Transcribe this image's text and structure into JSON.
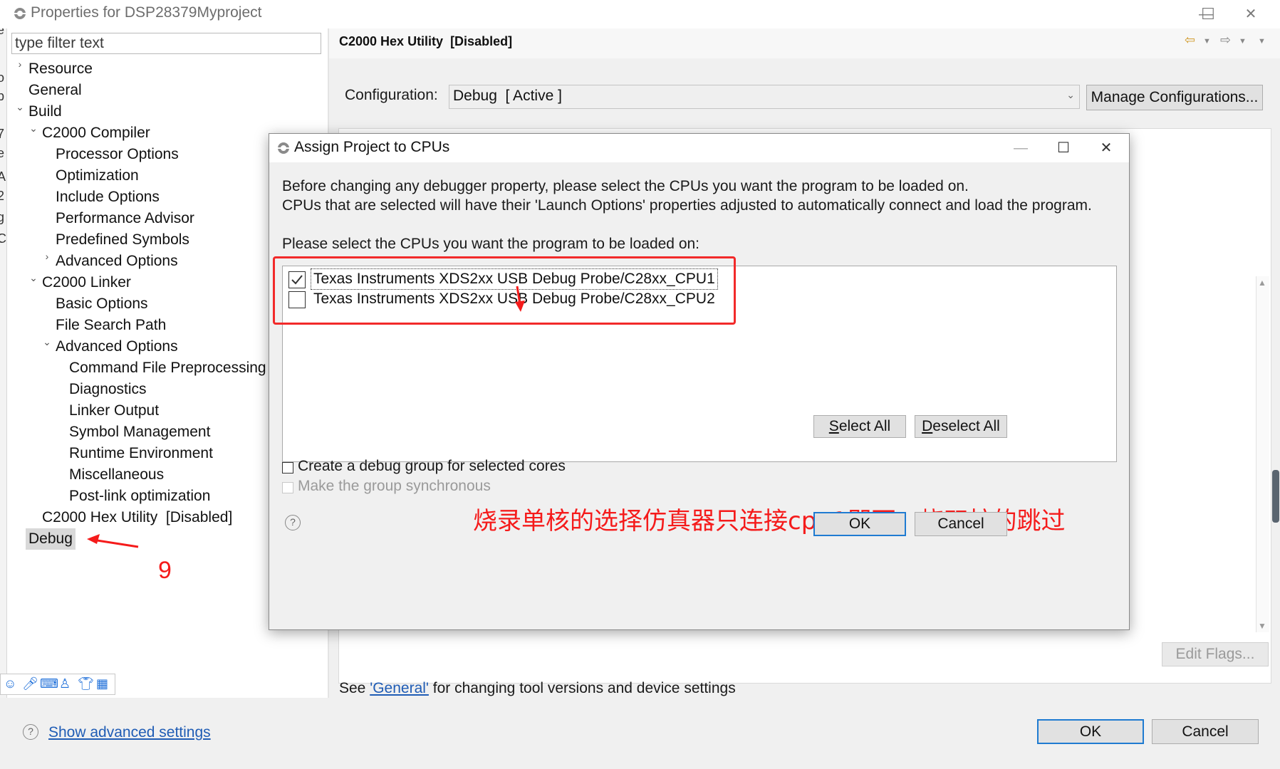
{
  "window": {
    "title": "Properties for DSP28379Myproject",
    "minimize_glyph": "—",
    "maximize_glyph": "☐",
    "close_glyph": "✕"
  },
  "left_strip_letters": [
    "e",
    "e",
    "o",
    "p",
    "7",
    "e",
    "A",
    "2",
    "g",
    "C"
  ],
  "filter": {
    "placeholder": "type filter text"
  },
  "tree": {
    "resource": "Resource",
    "general": "General",
    "build": "Build",
    "c2000_compiler": "C2000 Compiler",
    "processor_options": "Processor Options",
    "optimization": "Optimization",
    "include_options": "Include Options",
    "performance_advisor": "Performance Advisor",
    "predefined_symbols": "Predefined Symbols",
    "compiler_advanced_options": "Advanced Options",
    "c2000_linker": "C2000 Linker",
    "basic_options": "Basic Options",
    "file_search_path": "File Search Path",
    "linker_advanced_options": "Advanced Options",
    "command_file_preprocessing": "Command File Preprocessing",
    "diagnostics": "Diagnostics",
    "linker_output": "Linker Output",
    "symbol_management": "Symbol Management",
    "runtime_environment": "Runtime Environment",
    "miscellaneous": "Miscellaneous",
    "post_link_optimization": "Post-link optimization",
    "c2000_hex_utility": "C2000 Hex Utility  [Disabled]",
    "debug": "Debug"
  },
  "right_panel": {
    "header_title": "C2000 Hex Utility  [Disabled]",
    "configuration_label": "Configuration:",
    "configuration_value": "Debug  [ Active ]",
    "manage_configurations": "Manage Configurations...",
    "edit_flags": "Edit Flags...",
    "see_prefix": "See ",
    "see_link": "'General'",
    "see_suffix": " for changing tool versions and device settings"
  },
  "bottom": {
    "show_advanced_settings": "Show advanced settings",
    "ok": "OK",
    "cancel": "Cancel"
  },
  "dialog": {
    "title": "Assign Project to CPUs",
    "intro_line1": "Before changing any debugger property, please select the CPUs you want the program to be loaded on.",
    "intro_line2": "CPUs that are selected will have their 'Launch Options' properties adjusted to automatically connect and load the program.",
    "select_prompt": "Please select the CPUs you want the program to be loaded on:",
    "cpus": [
      {
        "label": "Texas Instruments XDS2xx USB Debug Probe/C28xx_CPU1",
        "checked": true
      },
      {
        "label": "Texas Instruments XDS2xx USB Debug Probe/C28xx_CPU2",
        "checked": false
      }
    ],
    "select_all_accel": "S",
    "select_all_rest": "elect All",
    "deselect_all_accel": "D",
    "deselect_all_rest": "eselect All",
    "create_debug_group": "Create a debug group for selected cores",
    "make_group_synchronous": "Make the group synchronous",
    "ok": "OK",
    "cancel": "Cancel"
  },
  "annotations": {
    "chinese_note": "烧录单核的选择仿真器只连接cpu1即可，烧双核的跳过",
    "step_number": "9",
    "color": "#f51b1b"
  },
  "colors": {
    "accent_focus": "#1f7bd1",
    "link": "#1f5cb5",
    "selection": "#d9d9d9"
  }
}
